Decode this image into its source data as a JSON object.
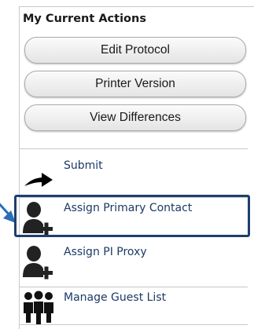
{
  "panel": {
    "title": "My Current Actions",
    "buttons": [
      {
        "label": "Edit Protocol"
      },
      {
        "label": "Printer Version"
      },
      {
        "label": "View Differences"
      }
    ],
    "actions": [
      {
        "label": "Submit",
        "icon": "arrow-right-icon"
      },
      {
        "label": "Assign Primary Contact",
        "icon": "user-add-icon"
      },
      {
        "label": "Assign PI Proxy",
        "icon": "user-add-icon"
      },
      {
        "label": "Manage Guest List",
        "icon": "group-icon"
      }
    ]
  },
  "colors": {
    "action_text": "#1c3a66",
    "highlight_border": "#1f3f6e",
    "pointer": "#2a6fb5"
  }
}
